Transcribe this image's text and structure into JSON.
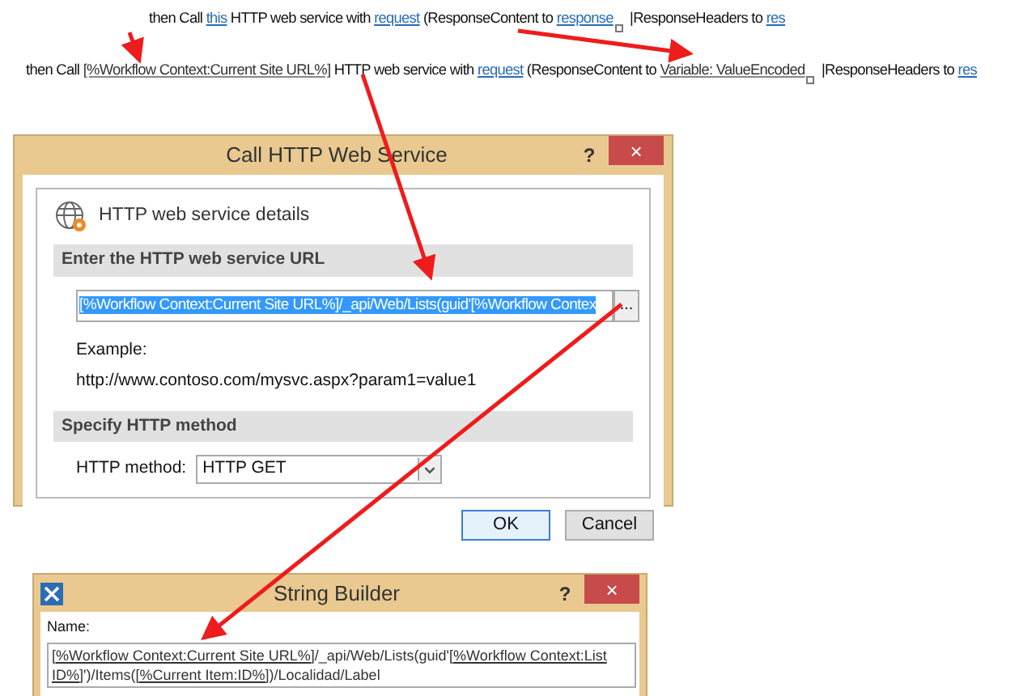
{
  "workflow_lines": [
    {
      "parts": [
        {
          "kind": "text",
          "text": "then Call "
        },
        {
          "kind": "link",
          "text": "this"
        },
        {
          "kind": "text",
          "text": " HTTP web service with "
        },
        {
          "kind": "link",
          "text": "request"
        },
        {
          "kind": "text",
          "text": " (ResponseContent to "
        },
        {
          "kind": "link",
          "text": "response",
          "handle": true
        },
        {
          "kind": "text",
          "text": " |ResponseHeaders to "
        },
        {
          "kind": "link",
          "text": "res"
        }
      ]
    },
    {
      "parts": [
        {
          "kind": "text",
          "text": "then Call "
        },
        {
          "kind": "field",
          "text": "[%Workflow Context:Current Site URL%]"
        },
        {
          "kind": "text",
          "text": " HTTP web service with "
        },
        {
          "kind": "link",
          "text": "request"
        },
        {
          "kind": "text",
          "text": " (ResponseContent to "
        },
        {
          "kind": "field",
          "text": "Variable: ValueEncoded",
          "handle": true
        },
        {
          "kind": "text",
          "text": " |ResponseHeaders to "
        },
        {
          "kind": "link",
          "text": "res"
        }
      ]
    }
  ],
  "http_dialog": {
    "title": "Call HTTP Web Service",
    "help": "?",
    "close": "×",
    "heading": "HTTP web service details",
    "url_section": "Enter the HTTP web service URL",
    "url_value": "[%Workflow Context:Current Site URL%]/_api/Web/Lists(guid'[%Workflow Contex",
    "url_selected": true,
    "browse": "...",
    "example_label": "Example:",
    "example_url": "http://www.contoso.com/mysvc.aspx?param1=value1",
    "method_section": "Specify HTTP method",
    "method_label": "HTTP method:",
    "method_value": "HTTP GET",
    "buttons": [
      {
        "label": "OK",
        "focused": true
      },
      {
        "label": "Cancel",
        "focused": false
      }
    ]
  },
  "string_builder": {
    "title": "String Builder",
    "help": "?",
    "close": "×",
    "name_label": "Name:",
    "lines": [
      [
        {
          "kind": "token",
          "text": "[%Workflow Context:Current Site URL%]"
        },
        {
          "kind": "text",
          "text": "/_api/Web/Lists(guid'"
        },
        {
          "kind": "token",
          "text": "[%Workflow Context:List"
        }
      ],
      [
        {
          "kind": "token",
          "text": "ID%]"
        },
        {
          "kind": "text",
          "text": "')/Items("
        },
        {
          "kind": "token",
          "text": "[%Current Item:ID%]"
        },
        {
          "kind": "text",
          "text": ")/Localidad/Label"
        }
      ]
    ]
  }
}
